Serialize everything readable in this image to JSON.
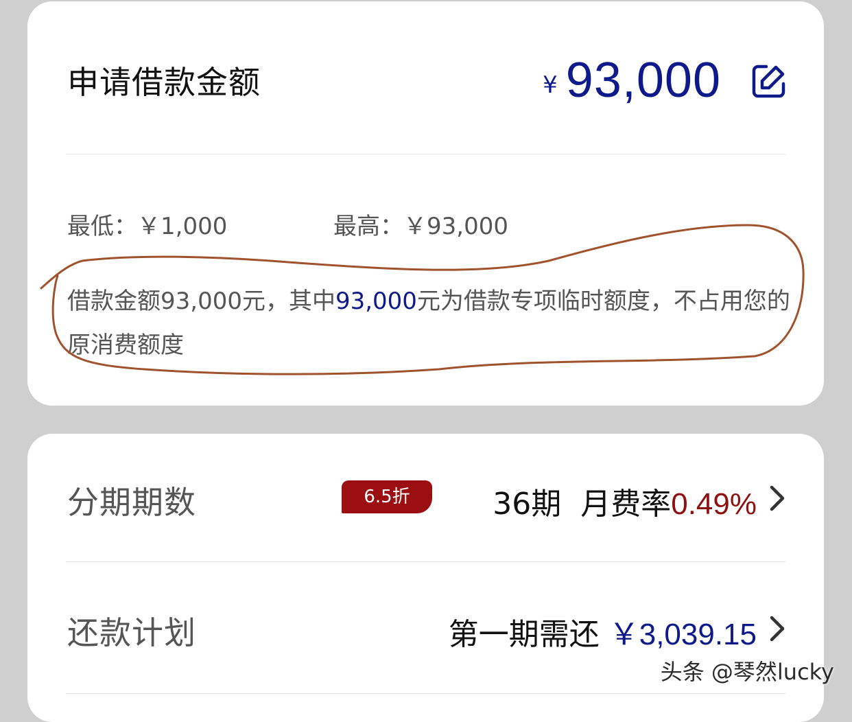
{
  "amount_card": {
    "title": "申请借款金额",
    "currency": "¥",
    "value": "93,000",
    "min_label": "最低：￥1,000",
    "max_label": "最高：￥93,000",
    "note_part1": "借款金额93,000元，其中",
    "note_highlight": "93,000",
    "note_part2": "元为借款专项临时额度，不占用您的原消费额度"
  },
  "installment": {
    "label": "分期期数",
    "badge": "6.5折",
    "periods": "36期",
    "rate_label": "月费率",
    "rate": "0.49%"
  },
  "repayment": {
    "label": "还款计划",
    "first_label": "第一期需还",
    "first_amount": "￥3,039.15"
  },
  "watermark": "头条 @琴然lucky",
  "colors": {
    "accent_blue": "#0f1a8a",
    "accent_red": "#8e1010",
    "badge_red": "#9b0f12",
    "annotation_circle": "#a0522d"
  }
}
